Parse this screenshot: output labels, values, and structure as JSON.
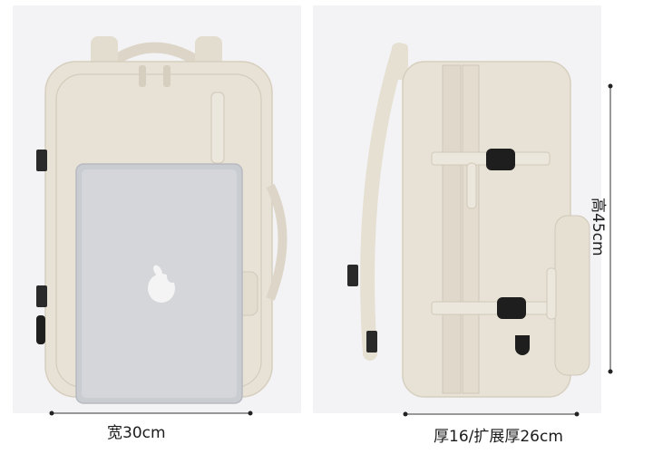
{
  "dimensions": {
    "width_label": "宽30cm",
    "height_label": "高45cm",
    "depth_label": "厚16/扩展厚26cm"
  },
  "colors": {
    "bag": "#e8e2d6",
    "bag_shadow": "#d9d2c3",
    "laptop": "#c9ccd1",
    "buckle": "#1e1e1e",
    "background": "#f3f3f5"
  },
  "icons": [
    "apple-logo-icon",
    "usb-port-icon",
    "buckle-icon"
  ]
}
